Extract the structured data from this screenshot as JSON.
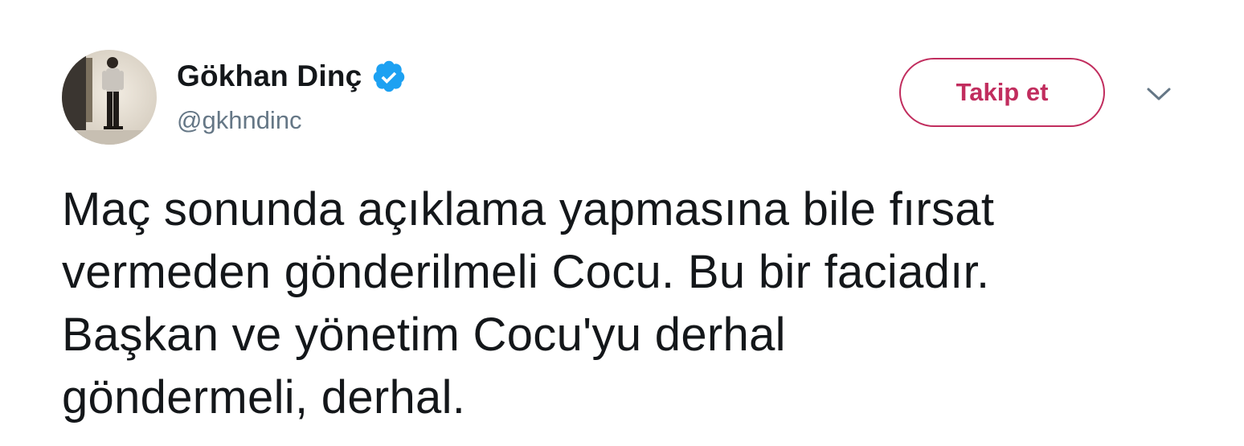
{
  "tweet": {
    "author": {
      "display_name": "Gökhan Dinç",
      "handle": "@gkhndinc",
      "verified": true,
      "avatar_icon": "profile-photo"
    },
    "follow_label": "Takip et",
    "text": "Maç sonunda açıklama yapmasına bile fırsat\nvermeden gönderilmeli Cocu. Bu bir faciadır.\nBaşkan ve yönetim Cocu'yu derhal\ngöndermeli, derhal.",
    "menu_icon": "chevron-down-icon"
  },
  "colors": {
    "accent": "#c12d5e",
    "verified_blue": "#1da1f2",
    "text_primary": "#14171a",
    "text_secondary": "#657786"
  }
}
